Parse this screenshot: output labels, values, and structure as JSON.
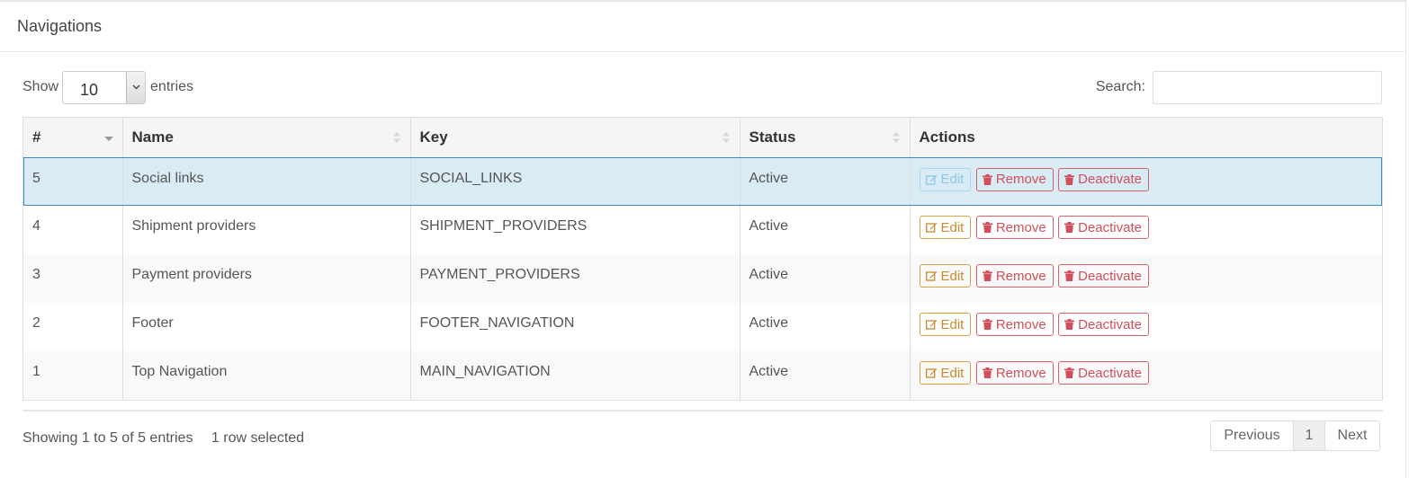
{
  "panel": {
    "title": "Navigations"
  },
  "length_menu": {
    "show_label": "Show",
    "value": "10",
    "entries_label": "entries"
  },
  "search": {
    "label": "Search:",
    "value": ""
  },
  "table": {
    "columns": [
      "#",
      "Name",
      "Key",
      "Status",
      "Actions"
    ],
    "rows": [
      {
        "id": "5",
        "name": "Social links",
        "key": "SOCIAL_LINKS",
        "status": "Active",
        "selected": true
      },
      {
        "id": "4",
        "name": "Shipment providers",
        "key": "SHIPMENT_PROVIDERS",
        "status": "Active",
        "selected": false
      },
      {
        "id": "3",
        "name": "Payment providers",
        "key": "PAYMENT_PROVIDERS",
        "status": "Active",
        "selected": false
      },
      {
        "id": "2",
        "name": "Footer",
        "key": "FOOTER_NAVIGATION",
        "status": "Active",
        "selected": false
      },
      {
        "id": "1",
        "name": "Top Navigation",
        "key": "MAIN_NAVIGATION",
        "status": "Active",
        "selected": false
      }
    ],
    "actions": {
      "edit": "Edit",
      "remove": "Remove",
      "deactivate": "Deactivate"
    }
  },
  "footer": {
    "info": "Showing 1 to 5 of 5 entries",
    "selected_info": "1 row selected",
    "pagination": {
      "previous": "Previous",
      "current": "1",
      "next": "Next"
    }
  },
  "colors": {
    "selected_row": "#d9ebf5",
    "edit": "#c88a2a",
    "danger": "#d04f5b"
  }
}
